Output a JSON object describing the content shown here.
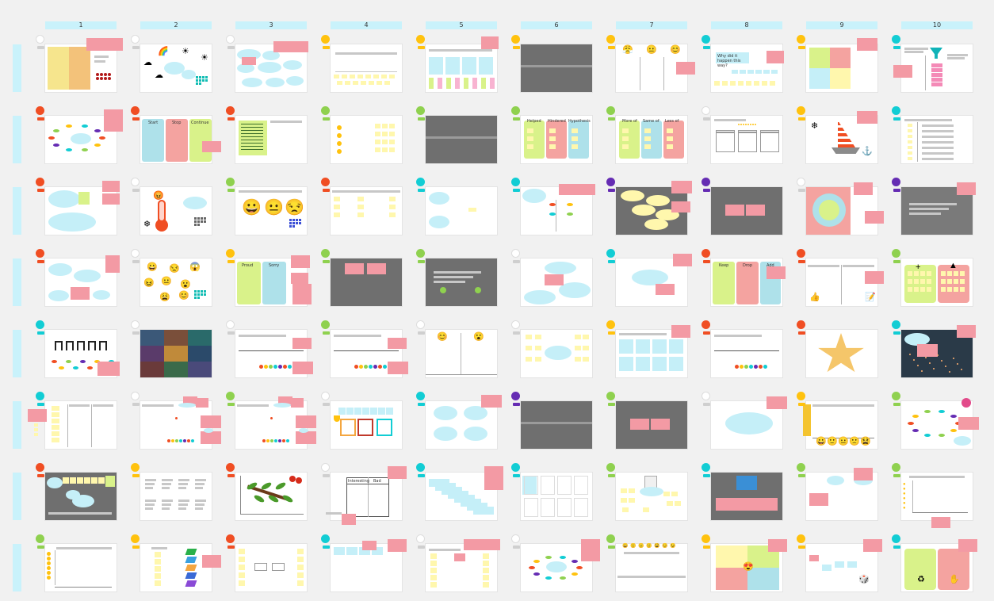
{
  "columns": [
    "1",
    "2",
    "3",
    "4",
    "5",
    "6",
    "7",
    "8",
    "9",
    "10"
  ],
  "frame_texts": {
    "r1c8_question": "Why did it happen this way?",
    "r2c2_start": "Start",
    "r2c2_stop": "Stop",
    "r2c2_continue": "Continue",
    "r2c6_helped": "Helped",
    "r2c6_hindered": "Hindered",
    "r2c6_hypothesis": "Hypothesis",
    "r2c7_more": "More of",
    "r2c7_same": "Same of",
    "r2c7_less": "Less of",
    "r4c3_proud": "Proud",
    "r4c3_sorry": "Sorry",
    "r4c8_keep": "Keep",
    "r4c8_drop": "Drop",
    "r4c8_add": "Add",
    "r7c4_interesting": "Interesting",
    "r7c4_bad": "Bad"
  },
  "colors": {
    "background": "#f1f1f1",
    "header": "#c9f2fb",
    "pink": "#f39aa4",
    "yellow": "#fff7ad",
    "cyan": "#c5eff8",
    "dark_frame": "#6f6f6f",
    "dot_red": "#f04e23",
    "dot_yellow": "#ffc20e",
    "dot_green": "#8fd14f",
    "dot_cyan": "#12cdd4",
    "dot_purple": "#652cb3",
    "dot_white": "#ffffff"
  },
  "icons": [
    "rainbow-icon",
    "sun-icon",
    "cloud-icon",
    "thermometer-icon",
    "funnel-icon",
    "sailboat-icon",
    "star-icon",
    "trophy-icon",
    "apple-branch-icon",
    "emoji-icon",
    "thumbs-up-icon",
    "recycle-icon"
  ]
}
